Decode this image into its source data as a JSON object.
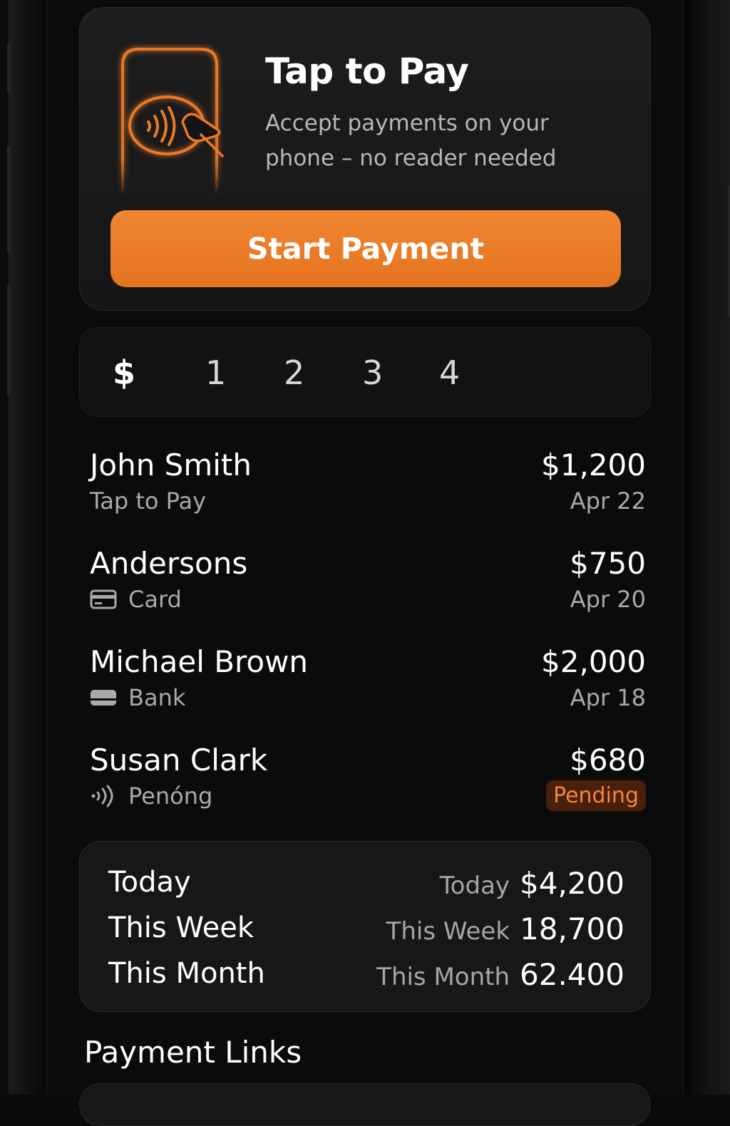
{
  "hero": {
    "title": "Tap to Pay",
    "subtitle": "Accept payments on your phone – no reader needed",
    "button_label": "Start Payment",
    "illustration_icon": "phone-tap-to-pay-icon",
    "accent_color": "#ea7a26"
  },
  "tabs": [
    "$",
    "1",
    "2",
    "3",
    "4"
  ],
  "transactions": [
    {
      "name": "John Smith",
      "method": "Tap to Pay",
      "method_icon": "",
      "amount": "$1,200",
      "date": "Apr 22",
      "status": ""
    },
    {
      "name": "Andersons",
      "method": "Card",
      "method_icon": "card-icon",
      "amount": "$750",
      "date": "Apr 20",
      "status": ""
    },
    {
      "name": "Michael Brown",
      "method": "Bank",
      "method_icon": "bank-icon",
      "amount": "$2,000",
      "date": "Apr 18",
      "status": ""
    },
    {
      "name": "Susan Clark",
      "method": "Penóng",
      "method_icon": "contactless-icon",
      "amount": "$680",
      "date": "",
      "status": "Pending"
    }
  ],
  "summary": {
    "rows": [
      {
        "label": "Today",
        "small_label": "Today",
        "value": "$4,200"
      },
      {
        "label": "This Week",
        "small_label": "This Week",
        "value": "18,700"
      },
      {
        "label": "This Month",
        "small_label": "This Month",
        "value": "62.400"
      }
    ]
  },
  "payment_links": {
    "title": "Payment Links"
  },
  "colors": {
    "background": "#0b0b0b",
    "card": "#171718",
    "accent": "#ea7a26",
    "pending_bg": "#4a1f0c",
    "pending_text": "#f4863a"
  }
}
